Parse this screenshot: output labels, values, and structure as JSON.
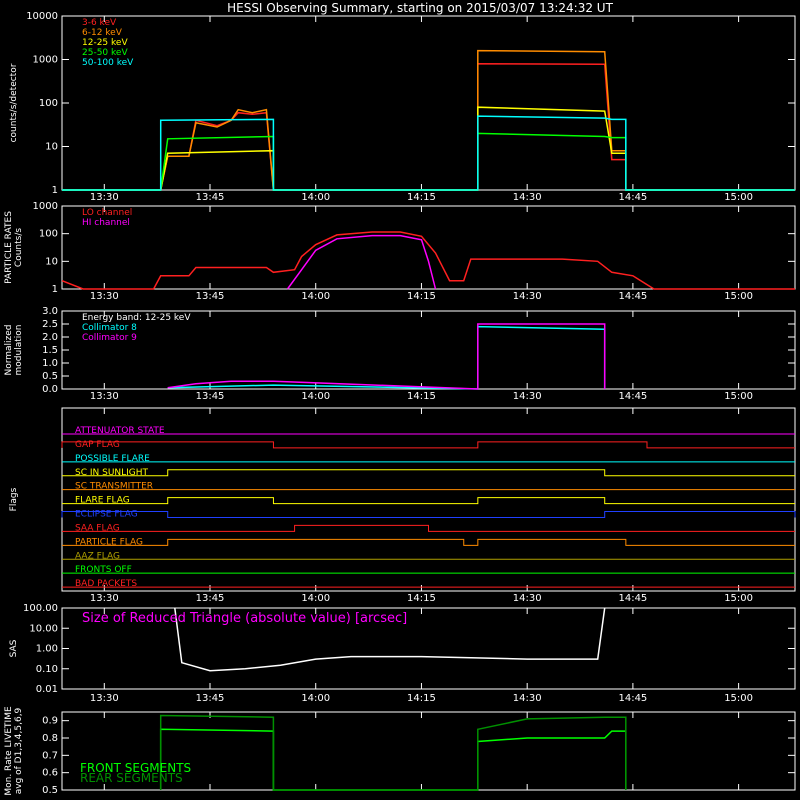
{
  "title": "HESSI Observing Summary, starting on 2015/03/07 13:24:32 UT",
  "colors": {
    "background": "#000000",
    "axes": "#ffffff",
    "red": "#ff2020",
    "orange": "#ff8c00",
    "yellow": "#ffff00",
    "green": "#00ff00",
    "cyan": "#00ffff",
    "magenta": "#ff00ff",
    "blue": "#2040ff",
    "olive": "#b0a000",
    "darkgreen": "#009000"
  },
  "time_axis": {
    "start": "13:24",
    "end": "15:08",
    "tick_labels": [
      "13:30",
      "13:45",
      "14:00",
      "14:15",
      "14:30",
      "14:45",
      "15:00"
    ]
  },
  "chart_data": [
    {
      "id": "counts",
      "type": "line",
      "ylabel": "counts/s/detector",
      "yscale": "log",
      "ylim": [
        1,
        10000
      ],
      "ytick_labels": [
        "1",
        "10",
        "100",
        "1000",
        "10000"
      ],
      "series": [
        {
          "name": "3-6 keV",
          "color": "red",
          "points": [
            [
              "13:24",
              "1"
            ],
            [
              "13:38",
              "1"
            ],
            [
              "13:39",
              "6"
            ],
            [
              "13:42",
              "6"
            ],
            [
              "13:43",
              "40"
            ],
            [
              "13:46",
              "30"
            ],
            [
              "13:48",
              "40"
            ],
            [
              "13:49",
              "60"
            ],
            [
              "13:51",
              "55"
            ],
            [
              "13:53",
              "60"
            ],
            [
              "13:54",
              "1"
            ],
            [
              "14:23",
              "1"
            ],
            [
              "14:23",
              "800"
            ],
            [
              "14:41",
              "780"
            ],
            [
              "14:42",
              "5"
            ],
            [
              "14:44",
              "5"
            ],
            [
              "14:44",
              "1"
            ],
            [
              "15:08",
              "1"
            ]
          ]
        },
        {
          "name": "6-12 keV",
          "color": "orange",
          "points": [
            [
              "13:24",
              "1"
            ],
            [
              "13:38",
              "1"
            ],
            [
              "13:39",
              "6"
            ],
            [
              "13:42",
              "6"
            ],
            [
              "13:43",
              "35"
            ],
            [
              "13:46",
              "28"
            ],
            [
              "13:48",
              "40"
            ],
            [
              "13:49",
              "70"
            ],
            [
              "13:51",
              "60"
            ],
            [
              "13:53",
              "70"
            ],
            [
              "13:54",
              "1"
            ],
            [
              "14:23",
              "1"
            ],
            [
              "14:23",
              "1600"
            ],
            [
              "14:41",
              "1500"
            ],
            [
              "14:42",
              "8"
            ],
            [
              "14:44",
              "8"
            ],
            [
              "14:44",
              "1"
            ],
            [
              "15:08",
              "1"
            ]
          ]
        },
        {
          "name": "12-25 keV",
          "color": "yellow",
          "points": [
            [
              "13:24",
              "1"
            ],
            [
              "13:38",
              "1"
            ],
            [
              "13:39",
              "7"
            ],
            [
              "13:54",
              "8"
            ],
            [
              "13:54",
              "1"
            ],
            [
              "14:23",
              "1"
            ],
            [
              "14:23",
              "80"
            ],
            [
              "14:41",
              "65"
            ],
            [
              "14:42",
              "7"
            ],
            [
              "14:44",
              "7"
            ],
            [
              "14:44",
              "1"
            ],
            [
              "15:08",
              "1"
            ]
          ]
        },
        {
          "name": "25-50 keV",
          "color": "green",
          "points": [
            [
              "13:24",
              "1"
            ],
            [
              "13:38",
              "1"
            ],
            [
              "13:39",
              "15"
            ],
            [
              "13:54",
              "17"
            ],
            [
              "13:54",
              "1"
            ],
            [
              "14:23",
              "1"
            ],
            [
              "14:23",
              "20"
            ],
            [
              "14:41",
              "17"
            ],
            [
              "14:42",
              "16"
            ],
            [
              "14:44",
              "16"
            ],
            [
              "14:44",
              "1"
            ],
            [
              "15:08",
              "1"
            ]
          ]
        },
        {
          "name": "50-100 keV",
          "color": "cyan",
          "points": [
            [
              "13:24",
              "1"
            ],
            [
              "13:38",
              "1"
            ],
            [
              "13:38",
              "40"
            ],
            [
              "13:54",
              "42"
            ],
            [
              "13:54",
              "1"
            ],
            [
              "14:23",
              "1"
            ],
            [
              "14:23",
              "50"
            ],
            [
              "14:41",
              "45"
            ],
            [
              "14:42",
              "42"
            ],
            [
              "14:44",
              "42"
            ],
            [
              "14:44",
              "1"
            ],
            [
              "15:08",
              "1"
            ]
          ]
        }
      ]
    },
    {
      "id": "particle",
      "type": "line",
      "ylabel": [
        "PARTICLE RATES",
        "Counts/s"
      ],
      "yscale": "log",
      "ylim": [
        1,
        1000
      ],
      "ytick_labels": [
        "1",
        "10",
        "100",
        "1000"
      ],
      "series": [
        {
          "name": "LO channel",
          "color": "red",
          "points": [
            [
              "13:24",
              "2"
            ],
            [
              "13:27",
              "1"
            ],
            [
              "13:37",
              "1"
            ],
            [
              "13:38",
              "3"
            ],
            [
              "13:42",
              "3"
            ],
            [
              "13:43",
              "6"
            ],
            [
              "13:53",
              "6"
            ],
            [
              "13:54",
              "4"
            ],
            [
              "13:57",
              "5"
            ],
            [
              "13:58",
              "15"
            ],
            [
              "14:00",
              "40"
            ],
            [
              "14:03",
              "90"
            ],
            [
              "14:08",
              "115"
            ],
            [
              "14:12",
              "115"
            ],
            [
              "14:15",
              "80"
            ],
            [
              "14:17",
              "20"
            ],
            [
              "14:19",
              "2"
            ],
            [
              "14:21",
              "2"
            ],
            [
              "14:22",
              "12"
            ],
            [
              "14:35",
              "12"
            ],
            [
              "14:40",
              "10"
            ],
            [
              "14:42",
              "4"
            ],
            [
              "14:45",
              "3"
            ],
            [
              "14:48",
              "1"
            ],
            [
              "15:08",
              "1"
            ]
          ]
        },
        {
          "name": "HI channel",
          "color": "magenta",
          "points": [
            [
              "13:56",
              "1"
            ],
            [
              "13:58",
              "5"
            ],
            [
              "14:00",
              "25"
            ],
            [
              "14:03",
              "65"
            ],
            [
              "14:08",
              "85"
            ],
            [
              "14:12",
              "85"
            ],
            [
              "14:15",
              "60"
            ],
            [
              "14:16",
              "10"
            ],
            [
              "14:17",
              "1"
            ]
          ]
        }
      ]
    },
    {
      "id": "modulation",
      "type": "line",
      "ylabel": [
        "Normalized",
        "modulation"
      ],
      "ylim": [
        0,
        3
      ],
      "ytick_labels": [
        "0.0",
        "0.5",
        "1.0",
        "1.5",
        "2.0",
        "2.5",
        "3.0"
      ],
      "annotation": "Energy band: 12-25 keV",
      "series": [
        {
          "name": "Collimator 8",
          "color": "cyan",
          "points": [
            [
              "13:39",
              "0.05"
            ],
            [
              "13:54",
              "0.15"
            ],
            [
              "14:23",
              "0.0"
            ],
            [
              "14:23",
              "2.4"
            ],
            [
              "14:41",
              "2.3"
            ],
            [
              "14:41",
              "0.0"
            ]
          ]
        },
        {
          "name": "Collimator 9",
          "color": "magenta",
          "points": [
            [
              "13:39",
              "0.05"
            ],
            [
              "13:43",
              "0.2"
            ],
            [
              "13:48",
              "0.3"
            ],
            [
              "13:54",
              "0.3"
            ],
            [
              "14:23",
              "0.0"
            ],
            [
              "14:23",
              "2.5"
            ],
            [
              "14:41",
              "2.5"
            ],
            [
              "14:41",
              "0.0"
            ]
          ]
        }
      ]
    },
    {
      "id": "flags",
      "type": "line",
      "ylabel": "Flags",
      "flags": [
        {
          "name": "ATTENUATOR STATE",
          "color": "magenta",
          "high": []
        },
        {
          "name": "GAP FLAG",
          "color": "red",
          "high": [
            [
              "13:24",
              "13:54"
            ],
            [
              "14:23",
              "14:47"
            ]
          ]
        },
        {
          "name": "POSSIBLE FLARE",
          "color": "cyan",
          "high": []
        },
        {
          "name": "SC IN SUNLIGHT",
          "color": "yellow",
          "high": [
            [
              "13:39",
              "14:41"
            ]
          ]
        },
        {
          "name": "SC TRANSMITTER",
          "color": "orange",
          "high": []
        },
        {
          "name": "FLARE FLAG",
          "color": "yellow",
          "high": [
            [
              "13:39",
              "13:54"
            ],
            [
              "14:23",
              "14:41"
            ]
          ]
        },
        {
          "name": "ECLIPSE FLAG",
          "color": "blue",
          "high": [
            [
              "13:24",
              "13:39"
            ],
            [
              "14:41",
              "15:08"
            ]
          ]
        },
        {
          "name": "SAA FLAG",
          "color": "red",
          "high": [
            [
              "13:57",
              "14:16"
            ]
          ]
        },
        {
          "name": "PARTICLE FLAG",
          "color": "orange",
          "high": [
            [
              "13:39",
              "14:21"
            ],
            [
              "14:23",
              "14:44"
            ]
          ]
        },
        {
          "name": "AAZ FLAG",
          "color": "olive",
          "high": []
        },
        {
          "name": "FRONTS OFF",
          "color": "green",
          "high": []
        },
        {
          "name": "BAD PACKETS",
          "color": "red",
          "high": []
        }
      ]
    },
    {
      "id": "sas",
      "type": "line",
      "ylabel": "SAS",
      "yscale": "log",
      "ylim": [
        0.01,
        100
      ],
      "ytick_labels": [
        "0.01",
        "0.10",
        "1.00",
        "10.00",
        "100.00"
      ],
      "annotation": "Size of Reduced Triangle (absolute value) [arcsec]",
      "series": [
        {
          "name": "",
          "color": "white",
          "points": [
            [
              "13:40",
              "100"
            ],
            [
              "13:41",
              "0.2"
            ],
            [
              "13:45",
              "0.08"
            ],
            [
              "13:50",
              "0.1"
            ],
            [
              "13:55",
              "0.15"
            ],
            [
              "14:00",
              "0.3"
            ],
            [
              "14:05",
              "0.4"
            ],
            [
              "14:15",
              "0.4"
            ],
            [
              "14:30",
              "0.3"
            ],
            [
              "14:40",
              "0.3"
            ],
            [
              "14:41",
              "100"
            ]
          ]
        }
      ]
    },
    {
      "id": "livetime",
      "type": "line",
      "ylabel": [
        "Mon. Rate LIVETIME",
        "avg of D1,3,4,5,6,9"
      ],
      "ylim": [
        0.5,
        0.95
      ],
      "ytick_labels": [
        "0.5",
        "0.6",
        "0.7",
        "0.8",
        "0.9"
      ],
      "series": [
        {
          "name": "FRONT SEGMENTS",
          "color": "green",
          "points": [
            [
              "13:38",
              "0.5"
            ],
            [
              "13:38",
              "0.85"
            ],
            [
              "13:54",
              "0.84"
            ],
            [
              "13:54",
              "0.5"
            ],
            [
              "14:23",
              "0.5"
            ],
            [
              "14:23",
              "0.78"
            ],
            [
              "14:30",
              "0.80"
            ],
            [
              "14:41",
              "0.80"
            ],
            [
              "14:42",
              "0.84"
            ],
            [
              "14:44",
              "0.84"
            ],
            [
              "14:44",
              "0.5"
            ]
          ]
        },
        {
          "name": "REAR SEGMENTS",
          "color": "darkgreen",
          "points": [
            [
              "13:38",
              "0.5"
            ],
            [
              "13:38",
              "0.93"
            ],
            [
              "13:54",
              "0.92"
            ],
            [
              "13:54",
              "0.5"
            ],
            [
              "14:23",
              "0.5"
            ],
            [
              "14:23",
              "0.85"
            ],
            [
              "14:30",
              "0.91"
            ],
            [
              "14:41",
              "0.92"
            ],
            [
              "14:44",
              "0.92"
            ],
            [
              "14:44",
              "0.5"
            ]
          ]
        }
      ]
    }
  ]
}
